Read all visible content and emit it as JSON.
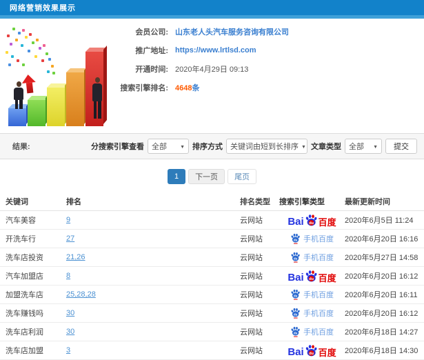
{
  "header": {
    "title": "网络营销效果展示"
  },
  "info": {
    "fields": [
      {
        "label": "会员公司:",
        "value": "山东老人头汽车服务咨询有限公司"
      },
      {
        "label": "推广地址:",
        "value": "https://www.lrtlsd.com"
      },
      {
        "label": "开通时间:",
        "value": "2020年4月29日 09:13"
      },
      {
        "label": "搜索引擎排名:",
        "value": "4648",
        "suffix": "条"
      }
    ]
  },
  "filters": {
    "result_label": "结果:",
    "engine_label": "分搜索引擎查看",
    "engine_value": "全部",
    "sort_label": "排序方式",
    "sort_value": "关键词由短到长排序",
    "article_label": "文章类型",
    "article_value": "全部",
    "submit_label": "提交"
  },
  "pagination": {
    "current": "1",
    "next": "下一页",
    "last": "尾页"
  },
  "table": {
    "headers": [
      "关键词",
      "排名",
      "排名类型",
      "搜索引擎类型",
      "最新更新时间"
    ],
    "branding": {
      "bai": "Bai",
      "du": "du",
      "cn": "百度",
      "mobile_label": "手机百度"
    },
    "rows": [
      {
        "keyword": "汽车美容",
        "rank": "9",
        "rank_type": "云网站",
        "engine": "baidu-pc",
        "time": "2020年6月5日 11:24"
      },
      {
        "keyword": "开洗车行",
        "rank": "27",
        "rank_type": "云网站",
        "engine": "baidu-mobile",
        "time": "2020年6月20日 16:16"
      },
      {
        "keyword": "洗车店投资",
        "rank": "21,26",
        "rank_type": "云网站",
        "engine": "baidu-mobile",
        "time": "2020年5月27日 14:58"
      },
      {
        "keyword": "汽车加盟店",
        "rank": "8",
        "rank_type": "云网站",
        "engine": "baidu-pc",
        "time": "2020年6月20日 16:12"
      },
      {
        "keyword": "加盟洗车店",
        "rank": "25,28,28",
        "rank_type": "云网站",
        "engine": "baidu-mobile",
        "time": "2020年6月20日 16:11"
      },
      {
        "keyword": "洗车赚钱吗",
        "rank": "30",
        "rank_type": "云网站",
        "engine": "baidu-mobile",
        "time": "2020年6月20日 16:12"
      },
      {
        "keyword": "洗车店利润",
        "rank": "30",
        "rank_type": "云网站",
        "engine": "baidu-mobile",
        "time": "2020年6月18日 14:27"
      },
      {
        "keyword": "洗车店加盟",
        "rank": "3",
        "rank_type": "云网站",
        "engine": "baidu-pc",
        "time": "2020年6月18日 14:30"
      }
    ]
  },
  "colors": {
    "topbar": "#1282ca",
    "topbar_strip": "#3fa0d9",
    "link": "#3a7fd0",
    "rank": "#4a90d2",
    "highlight": "#ff5a00",
    "baidu_blue": "#2534e0",
    "baidu_red": "#e10505",
    "page_current": "#2e7cba"
  }
}
